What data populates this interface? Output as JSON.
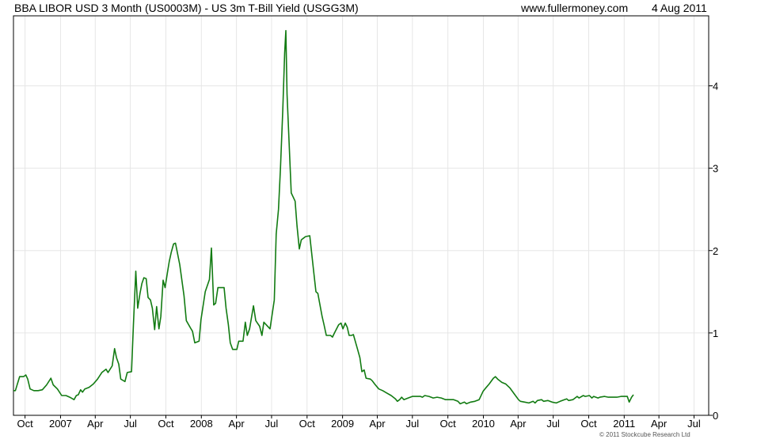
{
  "header": {
    "title": "BBA LIBOR USD 3 Month (US0003M) - US 3m T-Bill Yield (USGG3M)",
    "site": "www.fullermoney.com",
    "date": "4 Aug 2011"
  },
  "footer": {
    "copyright": "© 2011 Stockcube Research Ltd"
  },
  "colors": {
    "line": "#127b12",
    "grid": "#e6e6e6",
    "frame": "#000000"
  },
  "chart_data": {
    "type": "line",
    "title": "BBA LIBOR USD 3 Month (US0003M) - US 3m T-Bill Yield (USGG3M)",
    "xlabel": "",
    "ylabel": "",
    "y_axis_side": "right",
    "ylim": [
      0,
      4.85
    ],
    "xlim": [
      "2006-09-01",
      "2011-08-08"
    ],
    "grid": true,
    "x_ticks": [
      {
        "label": "Oct",
        "date": "2006-10-01"
      },
      {
        "label": "2007",
        "date": "2007-01-01"
      },
      {
        "label": "Apr",
        "date": "2007-04-01"
      },
      {
        "label": "Jul",
        "date": "2007-07-01"
      },
      {
        "label": "Oct",
        "date": "2007-10-01"
      },
      {
        "label": "2008",
        "date": "2008-01-01"
      },
      {
        "label": "Apr",
        "date": "2008-04-01"
      },
      {
        "label": "Jul",
        "date": "2008-07-01"
      },
      {
        "label": "Oct",
        "date": "2008-10-01"
      },
      {
        "label": "2009",
        "date": "2009-01-01"
      },
      {
        "label": "Apr",
        "date": "2009-04-01"
      },
      {
        "label": "Jul",
        "date": "2009-07-01"
      },
      {
        "label": "Oct",
        "date": "2009-10-01"
      },
      {
        "label": "2010",
        "date": "2010-01-01"
      },
      {
        "label": "Apr",
        "date": "2010-04-01"
      },
      {
        "label": "Jul",
        "date": "2010-07-01"
      },
      {
        "label": "Oct",
        "date": "2010-10-01"
      },
      {
        "label": "2011",
        "date": "2011-01-01"
      },
      {
        "label": "Apr",
        "date": "2011-04-01"
      },
      {
        "label": "Jul",
        "date": "2011-07-01"
      }
    ],
    "y_ticks": [
      0,
      1,
      2,
      3,
      4
    ],
    "series": [
      {
        "name": "",
        "points": [
          [
            "2006-09-01",
            0.3
          ],
          [
            "2006-09-06",
            0.3
          ],
          [
            "2006-09-17",
            0.47
          ],
          [
            "2006-09-27",
            0.47
          ],
          [
            "2006-10-03",
            0.49
          ],
          [
            "2006-10-08",
            0.44
          ],
          [
            "2006-10-14",
            0.32
          ],
          [
            "2006-10-24",
            0.3
          ],
          [
            "2006-11-04",
            0.3
          ],
          [
            "2006-11-15",
            0.31
          ],
          [
            "2006-11-26",
            0.37
          ],
          [
            "2006-12-07",
            0.45
          ],
          [
            "2006-12-13",
            0.37
          ],
          [
            "2006-12-24",
            0.32
          ],
          [
            "2007-01-04",
            0.24
          ],
          [
            "2007-01-15",
            0.24
          ],
          [
            "2007-01-25",
            0.22
          ],
          [
            "2007-02-05",
            0.19
          ],
          [
            "2007-02-11",
            0.24
          ],
          [
            "2007-02-16",
            0.25
          ],
          [
            "2007-02-22",
            0.31
          ],
          [
            "2007-02-27",
            0.28
          ],
          [
            "2007-03-05",
            0.32
          ],
          [
            "2007-03-16",
            0.34
          ],
          [
            "2007-03-27",
            0.38
          ],
          [
            "2007-04-07",
            0.44
          ],
          [
            "2007-04-18",
            0.52
          ],
          [
            "2007-04-29",
            0.56
          ],
          [
            "2007-05-04",
            0.52
          ],
          [
            "2007-05-15",
            0.6
          ],
          [
            "2007-05-21",
            0.81
          ],
          [
            "2007-05-26",
            0.7
          ],
          [
            "2007-06-01",
            0.62
          ],
          [
            "2007-06-06",
            0.44
          ],
          [
            "2007-06-17",
            0.41
          ],
          [
            "2007-06-23",
            0.52
          ],
          [
            "2007-07-04",
            0.53
          ],
          [
            "2007-07-09",
            1.1
          ],
          [
            "2007-07-15",
            1.75
          ],
          [
            "2007-07-20",
            1.3
          ],
          [
            "2007-07-26",
            1.48
          ],
          [
            "2007-07-31",
            1.6
          ],
          [
            "2007-08-05",
            1.67
          ],
          [
            "2007-08-11",
            1.66
          ],
          [
            "2007-08-16",
            1.43
          ],
          [
            "2007-08-22",
            1.4
          ],
          [
            "2007-08-27",
            1.3
          ],
          [
            "2007-09-02",
            1.04
          ],
          [
            "2007-09-07",
            1.32
          ],
          [
            "2007-09-13",
            1.05
          ],
          [
            "2007-09-18",
            1.2
          ],
          [
            "2007-09-24",
            1.64
          ],
          [
            "2007-09-29",
            1.55
          ],
          [
            "2007-10-05",
            1.73
          ],
          [
            "2007-10-10",
            1.87
          ],
          [
            "2007-10-15",
            1.98
          ],
          [
            "2007-10-21",
            2.08
          ],
          [
            "2007-10-26",
            2.09
          ],
          [
            "2007-11-06",
            1.83
          ],
          [
            "2007-11-17",
            1.45
          ],
          [
            "2007-11-23",
            1.15
          ],
          [
            "2007-12-04",
            1.06
          ],
          [
            "2007-12-09",
            1.02
          ],
          [
            "2007-12-15",
            0.88
          ],
          [
            "2007-12-26",
            0.9
          ],
          [
            "2007-12-31",
            1.16
          ],
          [
            "2008-01-11",
            1.5
          ],
          [
            "2008-01-22",
            1.65
          ],
          [
            "2008-01-27",
            2.03
          ],
          [
            "2008-02-02",
            1.34
          ],
          [
            "2008-02-07",
            1.36
          ],
          [
            "2008-02-13",
            1.55
          ],
          [
            "2008-02-18",
            1.55
          ],
          [
            "2008-02-29",
            1.55
          ],
          [
            "2008-03-05",
            1.3
          ],
          [
            "2008-03-11",
            1.1
          ],
          [
            "2008-03-16",
            0.88
          ],
          [
            "2008-03-22",
            0.8
          ],
          [
            "2008-04-02",
            0.8
          ],
          [
            "2008-04-07",
            0.9
          ],
          [
            "2008-04-18",
            0.9
          ],
          [
            "2008-04-24",
            1.13
          ],
          [
            "2008-04-29",
            0.97
          ],
          [
            "2008-05-05",
            1.05
          ],
          [
            "2008-05-15",
            1.33
          ],
          [
            "2008-05-21",
            1.15
          ],
          [
            "2008-05-31",
            1.08
          ],
          [
            "2008-06-06",
            0.97
          ],
          [
            "2008-06-11",
            1.13
          ],
          [
            "2008-06-27",
            1.05
          ],
          [
            "2008-07-08",
            1.4
          ],
          [
            "2008-07-13",
            2.2
          ],
          [
            "2008-07-19",
            2.5
          ],
          [
            "2008-07-24",
            3.0
          ],
          [
            "2008-07-30",
            3.7
          ],
          [
            "2008-08-04",
            4.4
          ],
          [
            "2008-08-07",
            4.67
          ],
          [
            "2008-08-10",
            3.9
          ],
          [
            "2008-08-21",
            2.7
          ],
          [
            "2008-08-31",
            2.6
          ],
          [
            "2008-09-05",
            2.3
          ],
          [
            "2008-09-11",
            2.02
          ],
          [
            "2008-09-16",
            2.13
          ],
          [
            "2008-09-27",
            2.17
          ],
          [
            "2008-10-08",
            2.18
          ],
          [
            "2008-10-18",
            1.75
          ],
          [
            "2008-10-24",
            1.5
          ],
          [
            "2008-10-29",
            1.48
          ],
          [
            "2008-11-09",
            1.2
          ],
          [
            "2008-11-14",
            1.1
          ],
          [
            "2008-11-20",
            0.97
          ],
          [
            "2008-12-01",
            0.97
          ],
          [
            "2008-12-06",
            0.95
          ],
          [
            "2008-12-11",
            1.0
          ],
          [
            "2008-12-22",
            1.1
          ],
          [
            "2008-12-28",
            1.12
          ],
          [
            "2009-01-02",
            1.05
          ],
          [
            "2009-01-08",
            1.12
          ],
          [
            "2009-01-13",
            1.07
          ],
          [
            "2009-01-18",
            0.97
          ],
          [
            "2009-01-24",
            0.97
          ],
          [
            "2009-01-29",
            0.98
          ],
          [
            "2009-02-09",
            0.8
          ],
          [
            "2009-02-15",
            0.7
          ],
          [
            "2009-02-20",
            0.53
          ],
          [
            "2009-02-26",
            0.55
          ],
          [
            "2009-03-03",
            0.45
          ],
          [
            "2009-03-14",
            0.44
          ],
          [
            "2009-03-19",
            0.42
          ],
          [
            "2009-03-25",
            0.38
          ],
          [
            "2009-04-05",
            0.32
          ],
          [
            "2009-04-15",
            0.3
          ],
          [
            "2009-04-26",
            0.27
          ],
          [
            "2009-05-07",
            0.24
          ],
          [
            "2009-05-18",
            0.2
          ],
          [
            "2009-05-23",
            0.17
          ],
          [
            "2009-05-29",
            0.19
          ],
          [
            "2009-06-03",
            0.22
          ],
          [
            "2009-06-09",
            0.19
          ],
          [
            "2009-06-20",
            0.21
          ],
          [
            "2009-07-01",
            0.23
          ],
          [
            "2009-07-11",
            0.23
          ],
          [
            "2009-07-22",
            0.23
          ],
          [
            "2009-07-27",
            0.22
          ],
          [
            "2009-08-02",
            0.24
          ],
          [
            "2009-08-13",
            0.23
          ],
          [
            "2009-08-24",
            0.21
          ],
          [
            "2009-09-03",
            0.22
          ],
          [
            "2009-09-14",
            0.21
          ],
          [
            "2009-09-25",
            0.19
          ],
          [
            "2009-10-06",
            0.19
          ],
          [
            "2009-10-16",
            0.19
          ],
          [
            "2009-10-27",
            0.17
          ],
          [
            "2009-11-02",
            0.14
          ],
          [
            "2009-11-13",
            0.16
          ],
          [
            "2009-11-18",
            0.14
          ],
          [
            "2009-11-29",
            0.16
          ],
          [
            "2009-12-10",
            0.17
          ],
          [
            "2009-12-21",
            0.19
          ],
          [
            "2009-12-31",
            0.29
          ],
          [
            "2010-01-05",
            0.32
          ],
          [
            "2010-01-16",
            0.38
          ],
          [
            "2010-01-27",
            0.45
          ],
          [
            "2010-02-01",
            0.47
          ],
          [
            "2010-02-07",
            0.44
          ],
          [
            "2010-02-18",
            0.4
          ],
          [
            "2010-02-28",
            0.38
          ],
          [
            "2010-03-11",
            0.33
          ],
          [
            "2010-03-22",
            0.26
          ],
          [
            "2010-04-02",
            0.19
          ],
          [
            "2010-04-07",
            0.17
          ],
          [
            "2010-04-18",
            0.16
          ],
          [
            "2010-04-29",
            0.15
          ],
          [
            "2010-05-10",
            0.17
          ],
          [
            "2010-05-15",
            0.15
          ],
          [
            "2010-05-21",
            0.18
          ],
          [
            "2010-06-01",
            0.19
          ],
          [
            "2010-06-06",
            0.17
          ],
          [
            "2010-06-17",
            0.18
          ],
          [
            "2010-06-28",
            0.16
          ],
          [
            "2010-07-09",
            0.15
          ],
          [
            "2010-07-19",
            0.17
          ],
          [
            "2010-07-30",
            0.19
          ],
          [
            "2010-08-05",
            0.2
          ],
          [
            "2010-08-10",
            0.18
          ],
          [
            "2010-08-21",
            0.19
          ],
          [
            "2010-09-01",
            0.23
          ],
          [
            "2010-09-06",
            0.21
          ],
          [
            "2010-09-17",
            0.24
          ],
          [
            "2010-09-22",
            0.23
          ],
          [
            "2010-10-03",
            0.24
          ],
          [
            "2010-10-09",
            0.21
          ],
          [
            "2010-10-14",
            0.23
          ],
          [
            "2010-10-25",
            0.21
          ],
          [
            "2010-10-30",
            0.22
          ],
          [
            "2010-11-11",
            0.23
          ],
          [
            "2010-11-21",
            0.22
          ],
          [
            "2010-12-02",
            0.22
          ],
          [
            "2010-12-13",
            0.22
          ],
          [
            "2010-12-24",
            0.23
          ],
          [
            "2011-01-09",
            0.23
          ],
          [
            "2011-01-14",
            0.16
          ],
          [
            "2011-01-20",
            0.22
          ],
          [
            "2011-01-25",
            0.25
          ]
        ]
      }
    ]
  }
}
